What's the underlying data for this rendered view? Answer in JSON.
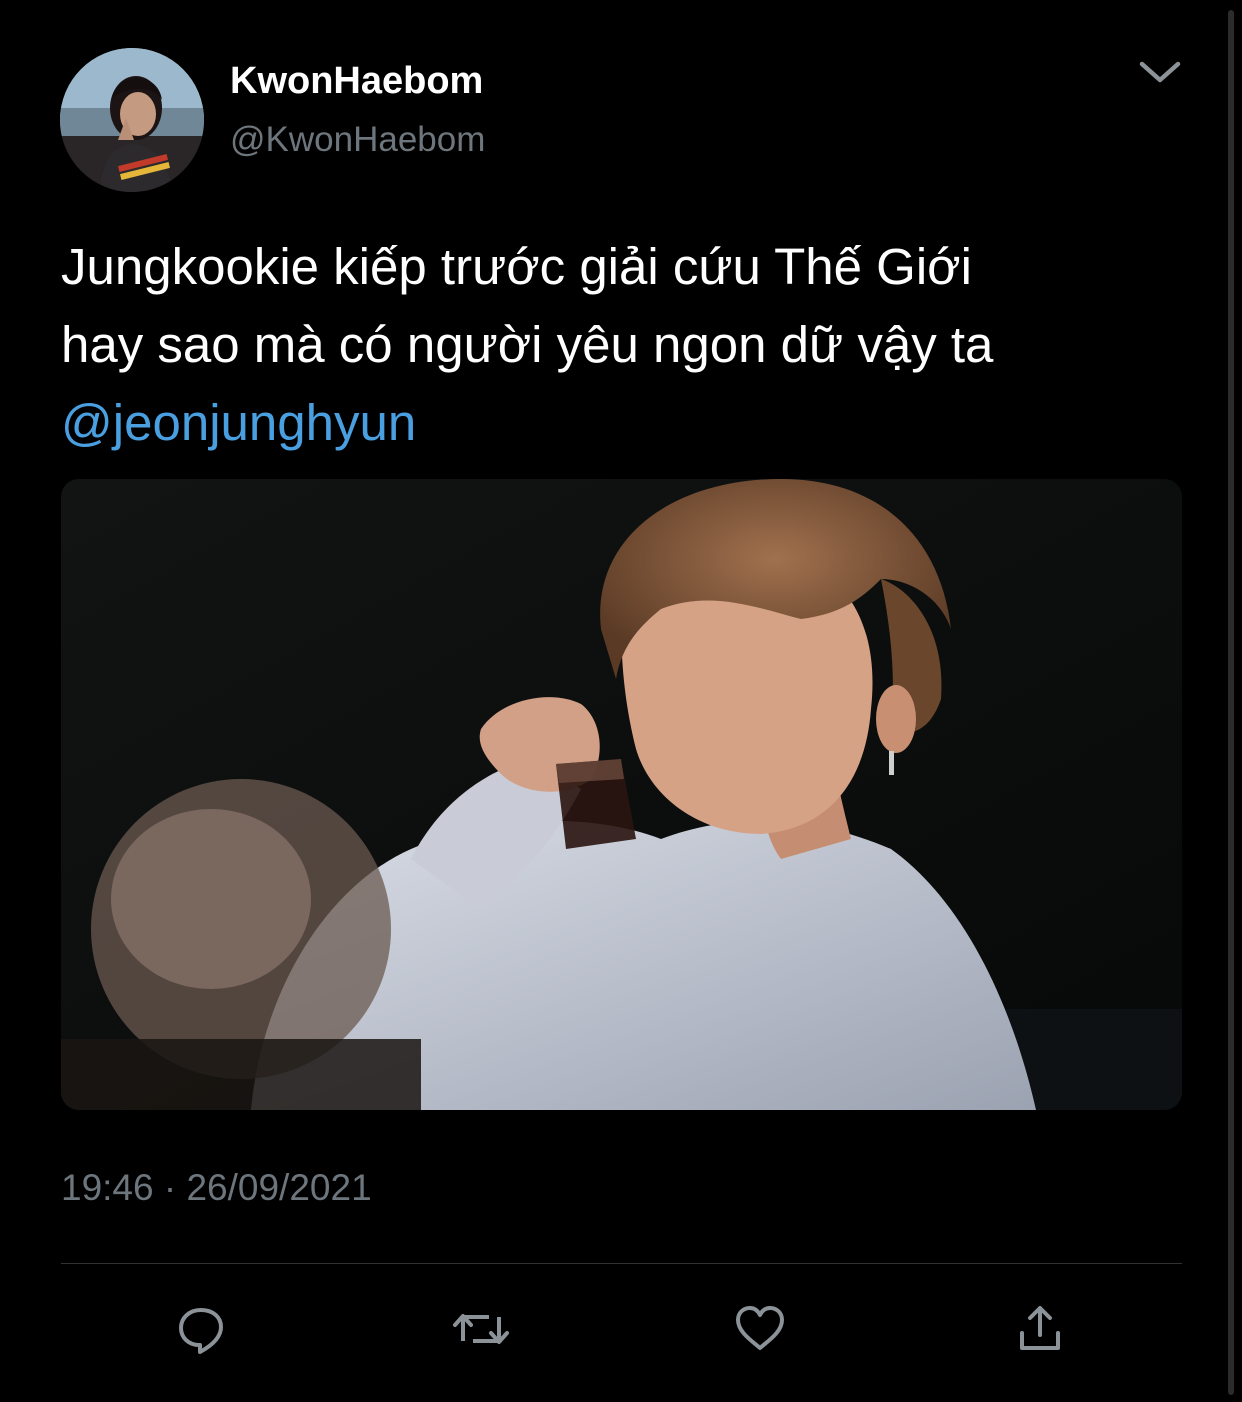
{
  "tweet": {
    "author": {
      "display_name": "KwonHaebom",
      "handle": "@KwonHaebom"
    },
    "text_line1": "Jungkookie kiếp trước giải cứu Thế Giới",
    "text_line2": "hay sao mà có người yêu ngon dữ vậy ta",
    "mention": "@jeonjunghyun",
    "timestamp": "19:46 · 26/09/2021"
  },
  "icons": {
    "menu": "chevron-down-icon",
    "reply": "reply-icon",
    "retweet": "retweet-icon",
    "like": "heart-icon",
    "share": "share-icon"
  },
  "colors": {
    "background": "#000000",
    "text": "#ffffff",
    "secondary": "#6e767d",
    "mention": "#4a9fe0",
    "divider": "#2f3336"
  }
}
